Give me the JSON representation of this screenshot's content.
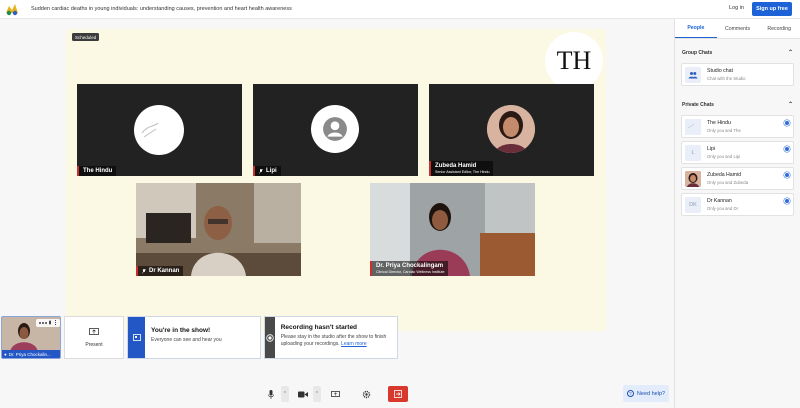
{
  "header": {
    "title": "Sudden cardiac deaths in young individuals: understanding causes, prevention and heart health awareness",
    "login_label": "Log in",
    "signup_label": "Sign up free"
  },
  "stage": {
    "badge": "Scheduled",
    "brand_logo_text": "TH",
    "tiles": [
      {
        "name": "The Hindu",
        "role": "",
        "muted": false
      },
      {
        "name": "Lipi",
        "role": "",
        "muted": true
      },
      {
        "name": "Zubeda Hamid",
        "role": "Senior Assistant Editor, The Hindu",
        "muted": false
      },
      {
        "name": "Dr Kannan",
        "role": "",
        "muted": true
      },
      {
        "name": "Dr. Priya Chockalingam",
        "role": "Clinical Director, Cardiac Wellness Institute",
        "muted": false
      }
    ]
  },
  "bottom": {
    "self_label": "Dr. Priya Chockalin...",
    "present_label": "Present",
    "in_show": {
      "title": "You're in the show!",
      "body": "Everyone can see and hear you"
    },
    "recording": {
      "title": "Recording hasn't started",
      "body": "Please stay in the studio after the show to finish uploading your recordings.",
      "link": "Learn more"
    },
    "help_label": "Need help?"
  },
  "panel": {
    "tabs": [
      {
        "label": "People",
        "active": true
      },
      {
        "label": "Comments",
        "active": false
      },
      {
        "label": "Recording",
        "active": false
      }
    ],
    "group_title": "Group Chats",
    "group_chats": [
      {
        "name": "Studio chat",
        "sub": "Chat with the Studio"
      }
    ],
    "private_title": "Private Chats",
    "private_chats": [
      {
        "name": "The Hindu",
        "sub": "Only you and The",
        "initials": ""
      },
      {
        "name": "Lipi",
        "sub": "Only you and Lipi",
        "initials": "L"
      },
      {
        "name": "Zubeda Hamid",
        "sub": "Only you and Zubeda",
        "initials": ""
      },
      {
        "name": "Dr Kannan",
        "sub": "Only you and Dr",
        "initials": "DK"
      }
    ]
  },
  "colors": {
    "accent": "#1d62d6",
    "leave": "#d9382c",
    "stage_bg": "#fbf9e4"
  }
}
